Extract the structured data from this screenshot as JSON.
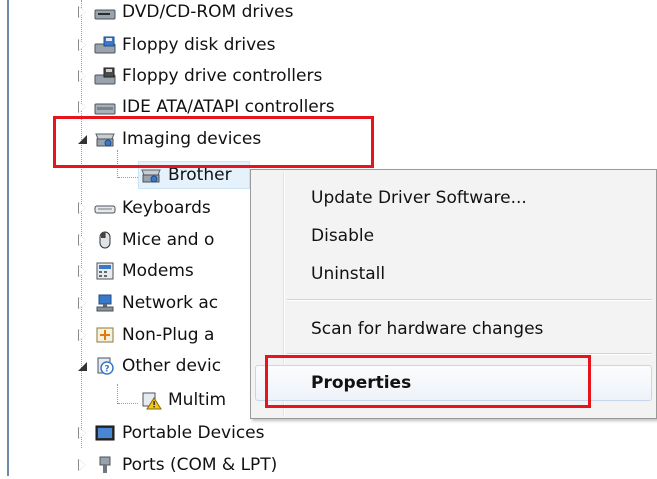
{
  "tree": {
    "items": [
      {
        "label": "DVD/CD-ROM drives",
        "state": "collapsed",
        "icon": "dvd-drive-icon"
      },
      {
        "label": "Floppy disk drives",
        "state": "collapsed",
        "icon": "floppy-disk-icon"
      },
      {
        "label": "Floppy drive controllers",
        "state": "collapsed",
        "icon": "floppy-controller-icon"
      },
      {
        "label": "IDE ATA/ATAPI controllers",
        "state": "collapsed",
        "icon": "ide-controller-icon"
      },
      {
        "label": "Imaging devices",
        "state": "expanded",
        "icon": "imaging-device-icon"
      },
      {
        "label": "Brother",
        "state": "child",
        "icon": "scanner-icon"
      },
      {
        "label": "Keyboards",
        "state": "collapsed",
        "icon": "keyboard-icon"
      },
      {
        "label": "Mice and o",
        "state": "collapsed",
        "icon": "mouse-icon"
      },
      {
        "label": "Modems",
        "state": "collapsed",
        "icon": "modem-icon"
      },
      {
        "label": "Network ac",
        "state": "collapsed",
        "icon": "network-adapter-icon"
      },
      {
        "label": "Non-Plug a",
        "state": "collapsed",
        "icon": "non-plug-icon"
      },
      {
        "label": "Other devic",
        "state": "expanded",
        "icon": "unknown-device-icon"
      },
      {
        "label": "Multim",
        "state": "child",
        "icon": "warning-device-icon"
      },
      {
        "label": "Portable Devices",
        "state": "collapsed",
        "icon": "portable-device-icon"
      },
      {
        "label": "Ports (COM & LPT)",
        "state": "collapsed",
        "icon": "port-icon"
      }
    ]
  },
  "context_menu": {
    "update_driver": "Update Driver Software...",
    "disable": "Disable",
    "uninstall": "Uninstall",
    "scan": "Scan for hardware changes",
    "properties": "Properties"
  },
  "colors": {
    "highlight_box": "#e8141c",
    "menu_background": "#f3f3f3"
  }
}
